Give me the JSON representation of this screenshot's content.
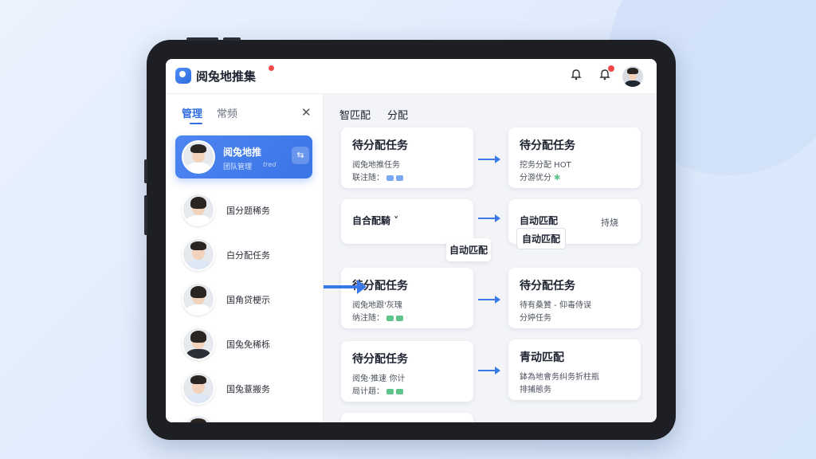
{
  "app": {
    "title": "阅兔地推集"
  },
  "sidebar": {
    "tabs": [
      {
        "label": "管理",
        "active": true
      },
      {
        "label": "常频",
        "active": false
      }
    ],
    "close_icon": "close-icon",
    "selected": {
      "name": "阅兔地推",
      "sub": "团队管理",
      "sub2": "tred"
    },
    "members": [
      {
        "label": "国分题稀务"
      },
      {
        "label": "白分配任务"
      },
      {
        "label": "国角贷梗示"
      },
      {
        "label": "国兔免稀栎"
      },
      {
        "label": "国兔薏搬务"
      }
    ]
  },
  "main": {
    "header_left": "智匹配",
    "header_right": "分配",
    "left_cards": [
      {
        "title": "待分配任务",
        "line1": "阅兔地推任务",
        "line2": "联注随：",
        "chips": [
          "#7aa8f5",
          "#7aa8f5"
        ]
      },
      {
        "title": "自合配騎 ˅",
        "line1": "",
        "line2": "",
        "chips": []
      },
      {
        "title": "待分配任务",
        "line1": "阅兔地跟'灰瑰",
        "line2": "纳注随：",
        "chips": [
          "#5dc48b",
          "#5dc48b"
        ]
      },
      {
        "title": "待分配任务",
        "line1": "阅兔·推速 你计",
        "line2": "局计趙：",
        "chips": [
          "#5dc48b",
          "#5dc48b"
        ]
      }
    ],
    "right_cards": [
      {
        "title": "待分配任务",
        "line1": "挖务分配 HOT",
        "line2": "分游优分",
        "chips": [
          "#5dc48b"
        ]
      },
      {
        "title": "自动匹配",
        "line1": "",
        "line2": "",
        "extra": "持烧",
        "chips": []
      },
      {
        "title": "待分配任务",
        "line1": "待有桑贊 - 仰毒侍误",
        "line2": "分婷任务",
        "chips": []
      },
      {
        "title": "青动匹配",
        "line1": "鉢為地會务纠务折柱瓶",
        "line2": "排捕態务",
        "chips": []
      }
    ],
    "float_label": "自动匹配"
  },
  "colors": {
    "accent": "#3b78e7",
    "badge": "#f04848"
  }
}
